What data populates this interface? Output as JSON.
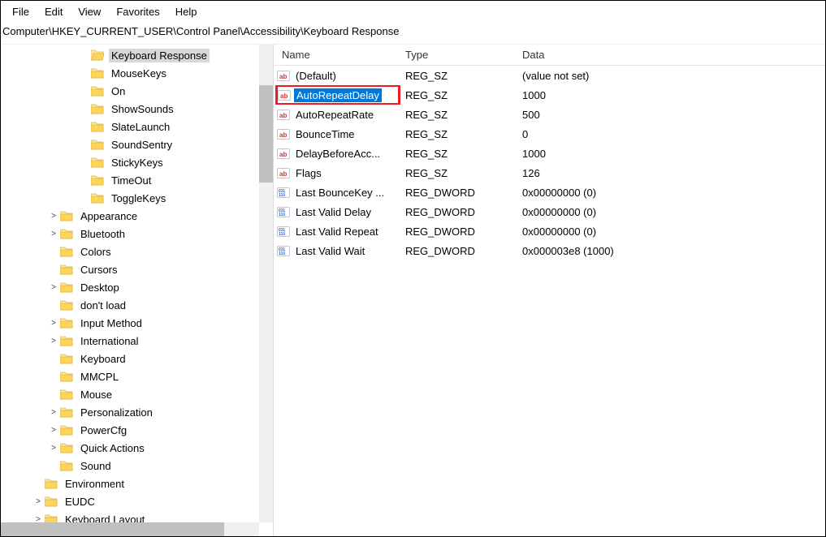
{
  "menubar": [
    "File",
    "Edit",
    "View",
    "Favorites",
    "Help"
  ],
  "address_label": "Computer\\HKEY_CURRENT_USER\\Control Panel\\Accessibility\\Keyboard Response",
  "tree": [
    {
      "indent": 95,
      "expander": "",
      "label": "Keyboard Response",
      "selected": true,
      "open": true
    },
    {
      "indent": 95,
      "expander": "",
      "label": "MouseKeys"
    },
    {
      "indent": 95,
      "expander": "",
      "label": "On"
    },
    {
      "indent": 95,
      "expander": "",
      "label": "ShowSounds"
    },
    {
      "indent": 95,
      "expander": "",
      "label": "SlateLaunch"
    },
    {
      "indent": 95,
      "expander": "",
      "label": "SoundSentry"
    },
    {
      "indent": 95,
      "expander": "",
      "label": "StickyKeys"
    },
    {
      "indent": 95,
      "expander": "",
      "label": "TimeOut"
    },
    {
      "indent": 95,
      "expander": "",
      "label": "ToggleKeys"
    },
    {
      "indent": 57,
      "expander": ">",
      "label": "Appearance"
    },
    {
      "indent": 57,
      "expander": ">",
      "label": "Bluetooth"
    },
    {
      "indent": 57,
      "expander": "",
      "label": "Colors"
    },
    {
      "indent": 57,
      "expander": "",
      "label": "Cursors"
    },
    {
      "indent": 57,
      "expander": ">",
      "label": "Desktop"
    },
    {
      "indent": 57,
      "expander": "",
      "label": "don't load"
    },
    {
      "indent": 57,
      "expander": ">",
      "label": "Input Method"
    },
    {
      "indent": 57,
      "expander": ">",
      "label": "International"
    },
    {
      "indent": 57,
      "expander": "",
      "label": "Keyboard"
    },
    {
      "indent": 57,
      "expander": "",
      "label": "MMCPL"
    },
    {
      "indent": 57,
      "expander": "",
      "label": "Mouse"
    },
    {
      "indent": 57,
      "expander": ">",
      "label": "Personalization"
    },
    {
      "indent": 57,
      "expander": ">",
      "label": "PowerCfg"
    },
    {
      "indent": 57,
      "expander": ">",
      "label": "Quick Actions"
    },
    {
      "indent": 57,
      "expander": "",
      "label": "Sound"
    },
    {
      "indent": 38,
      "expander": "",
      "label": "Environment"
    },
    {
      "indent": 38,
      "expander": ">",
      "label": "EUDC"
    },
    {
      "indent": 38,
      "expander": ">",
      "label": "Keyboard Layout"
    }
  ],
  "columns": {
    "name": "Name",
    "type": "Type",
    "data": "Data"
  },
  "values": [
    {
      "icon": "sz",
      "name": "(Default)",
      "type": "REG_SZ",
      "data": "(value not set)"
    },
    {
      "icon": "sz",
      "name": "AutoRepeatDelay",
      "type": "REG_SZ",
      "data": "1000",
      "selected": true,
      "highlighted": true
    },
    {
      "icon": "sz",
      "name": "AutoRepeatRate",
      "type": "REG_SZ",
      "data": "500"
    },
    {
      "icon": "sz",
      "name": "BounceTime",
      "type": "REG_SZ",
      "data": "0"
    },
    {
      "icon": "sz",
      "name": "DelayBeforeAcc...",
      "type": "REG_SZ",
      "data": "1000"
    },
    {
      "icon": "sz",
      "name": "Flags",
      "type": "REG_SZ",
      "data": "126"
    },
    {
      "icon": "dw",
      "name": "Last BounceKey ...",
      "type": "REG_DWORD",
      "data": "0x00000000 (0)"
    },
    {
      "icon": "dw",
      "name": "Last Valid Delay",
      "type": "REG_DWORD",
      "data": "0x00000000 (0)"
    },
    {
      "icon": "dw",
      "name": "Last Valid Repeat",
      "type": "REG_DWORD",
      "data": "0x00000000 (0)"
    },
    {
      "icon": "dw",
      "name": "Last Valid Wait",
      "type": "REG_DWORD",
      "data": "0x000003e8 (1000)"
    }
  ]
}
